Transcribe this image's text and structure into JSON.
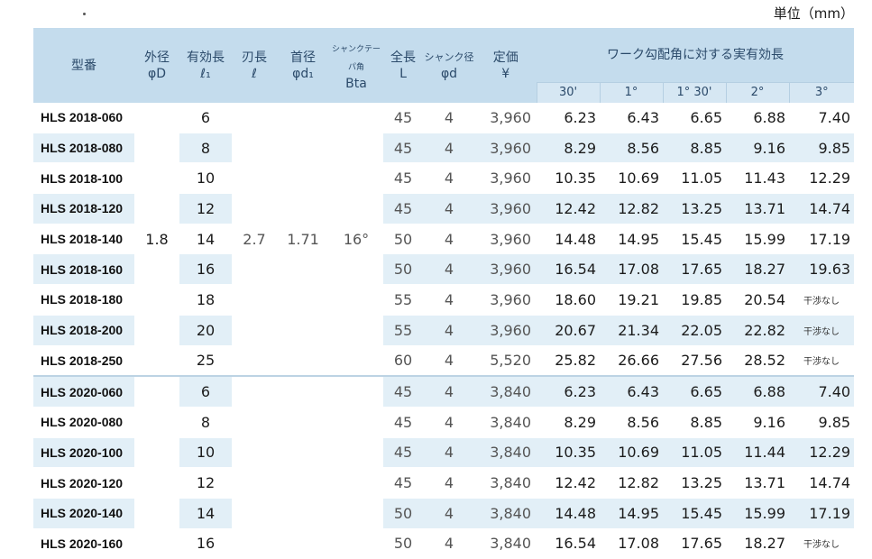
{
  "unit_label": "単位（mm）",
  "headers": {
    "model": "型番",
    "outer_dia": "外径",
    "outer_dia_sym": "φD",
    "effective_len": "有効長",
    "effective_len_sym": "ℓ₁",
    "blade_len": "刃長",
    "blade_len_sym": "ℓ",
    "neck_dia": "首径",
    "neck_dia_sym": "φd₁",
    "shank_taper": "シャンクテーパ角",
    "shank_taper_sym": "Bta",
    "total_len": "全長",
    "total_len_sym": "L",
    "shank_dia": "シャンク径",
    "shank_dia_sym": "φd",
    "price": "定価",
    "price_sym": "¥",
    "tilt_group": "ワーク勾配角に対する実有効長",
    "tilt_angles": [
      "30'",
      "1°",
      "1° 30'",
      "2°",
      "3°"
    ]
  },
  "groups": [
    {
      "outer_dia": "1.8",
      "blade_len": "2.7",
      "neck_dia": "1.71",
      "shank_taper": "16°",
      "rows": [
        {
          "model": "HLS 2018-060",
          "eff": "6",
          "L": "45",
          "d": "4",
          "price": "3,960",
          "v": [
            "6.23",
            "6.43",
            "6.65",
            "6.88",
            "7.40"
          ]
        },
        {
          "model": "HLS 2018-080",
          "eff": "8",
          "L": "45",
          "d": "4",
          "price": "3,960",
          "v": [
            "8.29",
            "8.56",
            "8.85",
            "9.16",
            "9.85"
          ]
        },
        {
          "model": "HLS 2018-100",
          "eff": "10",
          "L": "45",
          "d": "4",
          "price": "3,960",
          "v": [
            "10.35",
            "10.69",
            "11.05",
            "11.43",
            "12.29"
          ]
        },
        {
          "model": "HLS 2018-120",
          "eff": "12",
          "L": "45",
          "d": "4",
          "price": "3,960",
          "v": [
            "12.42",
            "12.82",
            "13.25",
            "13.71",
            "14.74"
          ]
        },
        {
          "model": "HLS 2018-140",
          "eff": "14",
          "L": "50",
          "d": "4",
          "price": "3,960",
          "v": [
            "14.48",
            "14.95",
            "15.45",
            "15.99",
            "17.19"
          ]
        },
        {
          "model": "HLS 2018-160",
          "eff": "16",
          "L": "50",
          "d": "4",
          "price": "3,960",
          "v": [
            "16.54",
            "17.08",
            "17.65",
            "18.27",
            "19.63"
          ]
        },
        {
          "model": "HLS 2018-180",
          "eff": "18",
          "L": "55",
          "d": "4",
          "price": "3,960",
          "v": [
            "18.60",
            "19.21",
            "19.85",
            "20.54",
            "干渉なし"
          ]
        },
        {
          "model": "HLS 2018-200",
          "eff": "20",
          "L": "55",
          "d": "4",
          "price": "3,960",
          "v": [
            "20.67",
            "21.34",
            "22.05",
            "22.82",
            "干渉なし"
          ]
        },
        {
          "model": "HLS 2018-250",
          "eff": "25",
          "L": "60",
          "d": "4",
          "price": "5,520",
          "v": [
            "25.82",
            "26.66",
            "27.56",
            "28.52",
            "干渉なし"
          ]
        }
      ]
    },
    {
      "rows": [
        {
          "model": "HLS 2020-060",
          "eff": "6",
          "L": "45",
          "d": "4",
          "price": "3,840",
          "v": [
            "6.23",
            "6.43",
            "6.65",
            "6.88",
            "7.40"
          ]
        },
        {
          "model": "HLS 2020-080",
          "eff": "8",
          "L": "45",
          "d": "4",
          "price": "3,840",
          "v": [
            "8.29",
            "8.56",
            "8.85",
            "9.16",
            "9.85"
          ]
        },
        {
          "model": "HLS 2020-100",
          "eff": "10",
          "L": "45",
          "d": "4",
          "price": "3,840",
          "v": [
            "10.35",
            "10.69",
            "11.05",
            "11.44",
            "12.29"
          ]
        },
        {
          "model": "HLS 2020-120",
          "eff": "12",
          "L": "45",
          "d": "4",
          "price": "3,840",
          "v": [
            "12.42",
            "12.82",
            "13.25",
            "13.71",
            "14.74"
          ]
        },
        {
          "model": "HLS 2020-140",
          "eff": "14",
          "L": "50",
          "d": "4",
          "price": "3,840",
          "v": [
            "14.48",
            "14.95",
            "15.45",
            "15.99",
            "17.19"
          ]
        },
        {
          "model": "HLS 2020-160",
          "eff": "16",
          "L": "50",
          "d": "4",
          "price": "3,840",
          "v": [
            "16.54",
            "17.08",
            "17.65",
            "18.27",
            "干渉なし"
          ]
        }
      ]
    }
  ],
  "colors": {
    "header_bg": "#c4dced",
    "row_shade": "#e2eff7",
    "header_text": "#2b4a6a"
  }
}
